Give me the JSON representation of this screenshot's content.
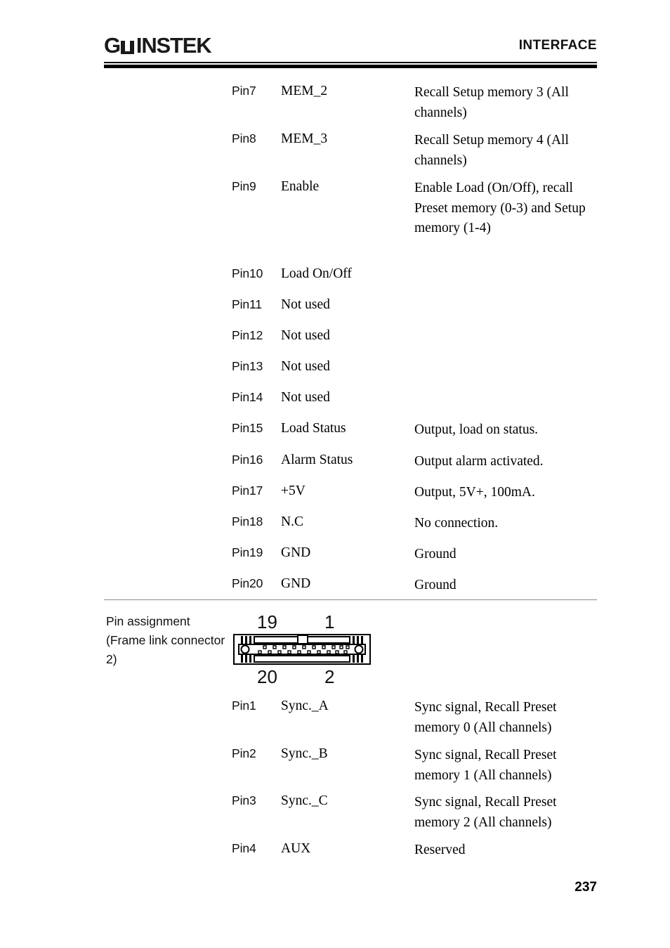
{
  "header": {
    "logo_text_1": "G",
    "logo_icon": "gw-instek-w-mark",
    "logo_text_2": "INSTEK",
    "title": "INTERFACE"
  },
  "table_top": {
    "rows": [
      {
        "pin": "Pin7",
        "name": "MEM_2",
        "desc": "Recall Setup memory 3 (All channels)"
      },
      {
        "pin": "Pin8",
        "name": "MEM_3",
        "desc": "Recall Setup memory 4 (All channels)"
      },
      {
        "pin": "Pin9",
        "name": "Enable",
        "desc": "Enable Load (On/Off), recall Preset memory (0-3) and Setup memory (1-4)"
      },
      {
        "pin": "Pin10",
        "name": "Load On/Off",
        "desc": ""
      },
      {
        "pin": "Pin11",
        "name": "Not used",
        "desc": ""
      },
      {
        "pin": "Pin12",
        "name": "Not used",
        "desc": ""
      },
      {
        "pin": "Pin13",
        "name": "Not used",
        "desc": ""
      },
      {
        "pin": "Pin14",
        "name": "Not used",
        "desc": ""
      },
      {
        "pin": "Pin15",
        "name": "Load Status",
        "desc": "Output, load on status."
      },
      {
        "pin": "Pin16",
        "name": "Alarm Status",
        "desc": "Output alarm activated."
      },
      {
        "pin": "Pin17",
        "name": "+5V",
        "desc": "Output, 5V+, 100mA."
      },
      {
        "pin": "Pin18",
        "name": "N.C",
        "desc": "No connection."
      },
      {
        "pin": "Pin19",
        "name": "GND",
        "desc": "Ground"
      },
      {
        "pin": "Pin20",
        "name": "GND",
        "desc": "Ground"
      }
    ]
  },
  "pin_assignment": {
    "label": "Pin assignment (Frame link connector 2)",
    "connector": {
      "top_left_number": "19",
      "top_right_number": "1",
      "bottom_left_number": "20",
      "bottom_right_number": "2",
      "icon": "d-sub-20-pin-connector-diagram"
    }
  },
  "table_bottom": {
    "rows": [
      {
        "pin": "Pin1",
        "name": "Sync._A",
        "desc": "Sync signal, Recall Preset memory 0 (All channels)"
      },
      {
        "pin": "Pin2",
        "name": "Sync._B",
        "desc": "Sync signal, Recall Preset memory 1 (All channels)"
      },
      {
        "pin": "Pin3",
        "name": "Sync._C",
        "desc": "Sync signal, Recall Preset memory 2 (All channels)"
      },
      {
        "pin": "Pin4",
        "name": "AUX",
        "desc": "Reserved"
      }
    ]
  },
  "footer": {
    "page_number": "237"
  },
  "layout": {
    "top_row_tops": [
      118,
      186,
      254,
      378,
      422,
      466,
      510,
      554,
      598,
      643,
      687,
      731,
      775,
      819
    ],
    "bottom_row_tops": [
      993,
      1061,
      1128,
      1196
    ]
  },
  "colors": {
    "text": "#000000",
    "rule": "#000000",
    "section_rule": "#8c8c8c",
    "background": "#ffffff"
  }
}
